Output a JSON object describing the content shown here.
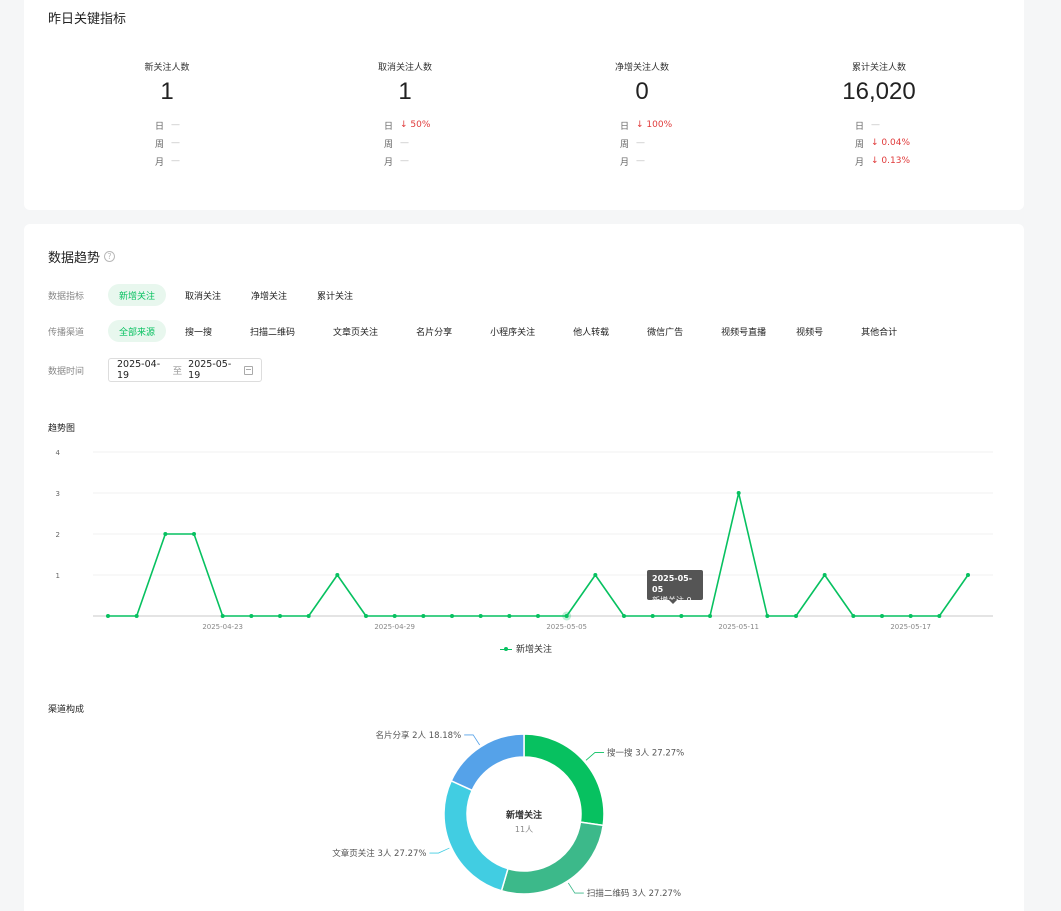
{
  "kpi": {
    "title": "昨日关键指标",
    "items": [
      {
        "label": "新关注人数",
        "value": "1",
        "rows": [
          {
            "label": "日",
            "value": "—",
            "down": false
          },
          {
            "label": "周",
            "value": "—",
            "down": false
          },
          {
            "label": "月",
            "value": "—",
            "down": false
          }
        ]
      },
      {
        "label": "取消关注人数",
        "value": "1",
        "rows": [
          {
            "label": "日",
            "value": "↓ 50%",
            "down": true
          },
          {
            "label": "周",
            "value": "—",
            "down": false
          },
          {
            "label": "月",
            "value": "—",
            "down": false
          }
        ]
      },
      {
        "label": "净增关注人数",
        "value": "0",
        "rows": [
          {
            "label": "日",
            "value": "↓ 100%",
            "down": true
          },
          {
            "label": "周",
            "value": "—",
            "down": false
          },
          {
            "label": "月",
            "value": "—",
            "down": false
          }
        ]
      },
      {
        "label": "累计关注人数",
        "value": "16,020",
        "rows": [
          {
            "label": "日",
            "value": "—",
            "down": false
          },
          {
            "label": "周",
            "value": "↓ 0.04%",
            "down": true
          },
          {
            "label": "月",
            "value": "↓ 0.13%",
            "down": true
          }
        ]
      }
    ]
  },
  "trend": {
    "title": "数据趋势",
    "help_icon": "question-circle-icon",
    "metric_label": "数据指标",
    "metrics": [
      "新增关注",
      "取消关注",
      "净增关注",
      "累计关注"
    ],
    "metric_active": 0,
    "channel_label": "传播渠道",
    "channels": [
      "全部来源",
      "搜一搜",
      "扫描二维码",
      "文章页关注",
      "名片分享",
      "小程序关注",
      "他人转载",
      "微信广告",
      "视频号直播",
      "视频号",
      "其他合计"
    ],
    "channel_active": 0,
    "date_label": "数据时间",
    "date_start": "2025-04-19",
    "date_sep": "至",
    "date_end": "2025-05-19",
    "calendar_icon": "calendar-icon",
    "trend_chart_label": "趋势图",
    "channel_chart_label": "渠道构成",
    "tooltip": {
      "date": "2025-05-05",
      "text": "新增关注 0"
    }
  },
  "colors": {
    "accent": "#07c160",
    "down": "#e03a3a"
  },
  "chart_data": [
    {
      "type": "line",
      "x": [
        "2025-04-19",
        "2025-04-20",
        "2025-04-21",
        "2025-04-22",
        "2025-04-23",
        "2025-04-24",
        "2025-04-25",
        "2025-04-26",
        "2025-04-27",
        "2025-04-28",
        "2025-04-29",
        "2025-04-30",
        "2025-05-01",
        "2025-05-02",
        "2025-05-03",
        "2025-05-04",
        "2025-05-05",
        "2025-05-06",
        "2025-05-07",
        "2025-05-08",
        "2025-05-09",
        "2025-05-10",
        "2025-05-11",
        "2025-05-12",
        "2025-05-13",
        "2025-05-14",
        "2025-05-15",
        "2025-05-16",
        "2025-05-17",
        "2025-05-18",
        "2025-05-19"
      ],
      "x_tick_labels": [
        "2025-04-23",
        "2025-04-29",
        "2025-05-05",
        "2025-05-11",
        "2025-05-17"
      ],
      "series": [
        {
          "name": "新增关注",
          "values": [
            0,
            0,
            2,
            2,
            0,
            0,
            0,
            0,
            1,
            0,
            0,
            0,
            0,
            0,
            0,
            0,
            0,
            1,
            0,
            0,
            0,
            0,
            3,
            0,
            0,
            1,
            0,
            0,
            0,
            0,
            1
          ]
        }
      ],
      "ylim": [
        0,
        4
      ],
      "y_ticks": [
        "1",
        "2",
        "3",
        "4"
      ],
      "grid": true,
      "legend": "bottom",
      "color": "#07c160"
    },
    {
      "type": "pie",
      "center_title": "新增关注",
      "center_value": "11人",
      "slices": [
        {
          "label": "搜一搜 3人 27.27%",
          "value": 3,
          "color": "#07c160"
        },
        {
          "label": "扫描二维码 3人 27.27%",
          "value": 3,
          "color": "#3cb98a"
        },
        {
          "label": "文章页关注 3人 27.27%",
          "value": 3,
          "color": "#41cde2"
        },
        {
          "label": "名片分享 2人 18.18%",
          "value": 2,
          "color": "#55a2e9"
        }
      ]
    }
  ]
}
